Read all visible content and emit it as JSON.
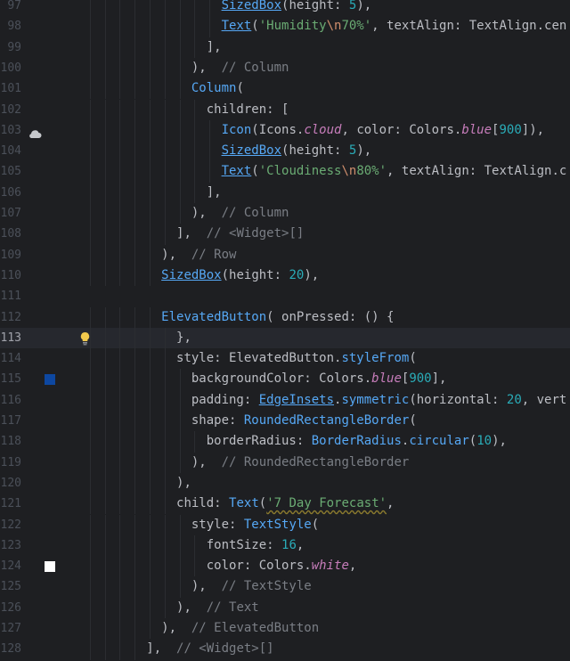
{
  "editor": {
    "current_line": 113,
    "lines": [
      {
        "n": "97",
        "indent": 10,
        "tokens": [
          {
            "t": "SizedBox",
            "c": "cls-u"
          },
          {
            "t": "(",
            "c": "pn"
          },
          {
            "t": "height: ",
            "c": "named"
          },
          {
            "t": "5",
            "c": "num"
          },
          {
            "t": "),",
            "c": "pn"
          }
        ]
      },
      {
        "n": "98",
        "indent": 10,
        "tokens": [
          {
            "t": "Text",
            "c": "cls-u"
          },
          {
            "t": "(",
            "c": "pn"
          },
          {
            "t": "'Humidity",
            "c": "str"
          },
          {
            "t": "\\n",
            "c": "esc"
          },
          {
            "t": "70%'",
            "c": "str"
          },
          {
            "t": ", ",
            "c": "pn"
          },
          {
            "t": "textAlign: ",
            "c": "named"
          },
          {
            "t": "TextAlign.cen",
            "c": "id"
          }
        ]
      },
      {
        "n": "99",
        "indent": 9,
        "tokens": [
          {
            "t": "],",
            "c": "pn"
          }
        ]
      },
      {
        "n": "100",
        "indent": 8,
        "tokens": [
          {
            "t": "),  ",
            "c": "pn"
          },
          {
            "t": "// Column",
            "c": "cm"
          }
        ]
      },
      {
        "n": "101",
        "indent": 8,
        "tokens": [
          {
            "t": "Column",
            "c": "cls"
          },
          {
            "t": "(",
            "c": "pn"
          }
        ]
      },
      {
        "n": "102",
        "indent": 9,
        "tokens": [
          {
            "t": "children: [",
            "c": "named"
          }
        ]
      },
      {
        "n": "103",
        "indent": 10,
        "gutter": "cloud-icon",
        "tokens": [
          {
            "t": "Icon",
            "c": "cls"
          },
          {
            "t": "(Icons.",
            "c": "pn"
          },
          {
            "t": "cloud",
            "c": "static"
          },
          {
            "t": ", color: Colors.",
            "c": "pn"
          },
          {
            "t": "blue",
            "c": "static"
          },
          {
            "t": "[",
            "c": "pn"
          },
          {
            "t": "900",
            "c": "num"
          },
          {
            "t": "]),",
            "c": "pn"
          }
        ]
      },
      {
        "n": "104",
        "indent": 10,
        "tokens": [
          {
            "t": "SizedBox",
            "c": "cls-u"
          },
          {
            "t": "(",
            "c": "pn"
          },
          {
            "t": "height: ",
            "c": "named"
          },
          {
            "t": "5",
            "c": "num"
          },
          {
            "t": "),",
            "c": "pn"
          }
        ]
      },
      {
        "n": "105",
        "indent": 10,
        "tokens": [
          {
            "t": "Text",
            "c": "cls-u"
          },
          {
            "t": "(",
            "c": "pn"
          },
          {
            "t": "'Cloudiness",
            "c": "str"
          },
          {
            "t": "\\n",
            "c": "esc"
          },
          {
            "t": "80%'",
            "c": "str"
          },
          {
            "t": ", ",
            "c": "pn"
          },
          {
            "t": "textAlign: ",
            "c": "named"
          },
          {
            "t": "TextAlign.c",
            "c": "id"
          }
        ]
      },
      {
        "n": "106",
        "indent": 9,
        "tokens": [
          {
            "t": "],",
            "c": "pn"
          }
        ]
      },
      {
        "n": "107",
        "indent": 8,
        "tokens": [
          {
            "t": "),  ",
            "c": "pn"
          },
          {
            "t": "// Column",
            "c": "cm"
          }
        ]
      },
      {
        "n": "108",
        "indent": 7,
        "tokens": [
          {
            "t": "],  ",
            "c": "pn"
          },
          {
            "t": "// <Widget>[]",
            "c": "cm"
          }
        ]
      },
      {
        "n": "109",
        "indent": 6,
        "tokens": [
          {
            "t": "),  ",
            "c": "pn"
          },
          {
            "t": "// Row",
            "c": "cm"
          }
        ]
      },
      {
        "n": "110",
        "indent": 6,
        "tokens": [
          {
            "t": "SizedBox",
            "c": "cls-u"
          },
          {
            "t": "(",
            "c": "pn"
          },
          {
            "t": "height: ",
            "c": "named"
          },
          {
            "t": "20",
            "c": "num"
          },
          {
            "t": "),",
            "c": "pn"
          }
        ]
      },
      {
        "n": "111",
        "indent": 0,
        "tokens": []
      },
      {
        "n": "112",
        "indent": 6,
        "tokens": [
          {
            "t": "ElevatedButton",
            "c": "cls"
          },
          {
            "t": "( onPressed: () {",
            "c": "pn"
          }
        ]
      },
      {
        "n": "113",
        "indent": 7,
        "gutter": "bulb-icon",
        "tokens": [
          {
            "t": "},",
            "c": "pn"
          }
        ]
      },
      {
        "n": "114",
        "indent": 7,
        "tokens": [
          {
            "t": "style: ElevatedButton.",
            "c": "pn"
          },
          {
            "t": "styleFrom",
            "c": "cls"
          },
          {
            "t": "(",
            "c": "pn"
          }
        ]
      },
      {
        "n": "115",
        "indent": 8,
        "gutter": "blue-swatch",
        "tokens": [
          {
            "t": "backgroundColor: Colors.",
            "c": "pn"
          },
          {
            "t": "blue",
            "c": "static"
          },
          {
            "t": "[",
            "c": "pn"
          },
          {
            "t": "900",
            "c": "num"
          },
          {
            "t": "],",
            "c": "pn"
          }
        ]
      },
      {
        "n": "116",
        "indent": 8,
        "tokens": [
          {
            "t": "padding: ",
            "c": "named"
          },
          {
            "t": "EdgeInsets",
            "c": "cls-u"
          },
          {
            "t": ".",
            "c": "pn"
          },
          {
            "t": "symmetric",
            "c": "cls"
          },
          {
            "t": "(horizontal: ",
            "c": "pn"
          },
          {
            "t": "20",
            "c": "num"
          },
          {
            "t": ", vert",
            "c": "pn"
          }
        ]
      },
      {
        "n": "117",
        "indent": 8,
        "tokens": [
          {
            "t": "shape: ",
            "c": "named"
          },
          {
            "t": "RoundedRectangleBorder",
            "c": "cls"
          },
          {
            "t": "(",
            "c": "pn"
          }
        ]
      },
      {
        "n": "118",
        "indent": 9,
        "tokens": [
          {
            "t": "borderRadius: ",
            "c": "named"
          },
          {
            "t": "BorderRadius",
            "c": "cls"
          },
          {
            "t": ".",
            "c": "pn"
          },
          {
            "t": "circular",
            "c": "cls"
          },
          {
            "t": "(",
            "c": "pn"
          },
          {
            "t": "10",
            "c": "num"
          },
          {
            "t": "),",
            "c": "pn"
          }
        ]
      },
      {
        "n": "119",
        "indent": 8,
        "tokens": [
          {
            "t": "),  ",
            "c": "pn"
          },
          {
            "t": "// RoundedRectangleBorder",
            "c": "cm"
          }
        ]
      },
      {
        "n": "120",
        "indent": 7,
        "tokens": [
          {
            "t": "),",
            "c": "pn"
          }
        ]
      },
      {
        "n": "121",
        "indent": 7,
        "tokens": [
          {
            "t": "child: ",
            "c": "named"
          },
          {
            "t": "Text",
            "c": "cls"
          },
          {
            "t": "(",
            "c": "pn"
          },
          {
            "t": "'7 Day Forecast'",
            "c": "str",
            "sq": true
          },
          {
            "t": ",",
            "c": "pn"
          }
        ]
      },
      {
        "n": "122",
        "indent": 8,
        "tokens": [
          {
            "t": "style: ",
            "c": "named"
          },
          {
            "t": "TextStyle",
            "c": "cls"
          },
          {
            "t": "(",
            "c": "pn"
          }
        ]
      },
      {
        "n": "123",
        "indent": 9,
        "tokens": [
          {
            "t": "fontSize: ",
            "c": "named"
          },
          {
            "t": "16",
            "c": "num"
          },
          {
            "t": ",",
            "c": "pn"
          }
        ]
      },
      {
        "n": "124",
        "indent": 9,
        "gutter": "white-swatch",
        "tokens": [
          {
            "t": "color: Colors.",
            "c": "pn"
          },
          {
            "t": "white",
            "c": "static"
          },
          {
            "t": ",",
            "c": "pn"
          }
        ]
      },
      {
        "n": "125",
        "indent": 8,
        "tokens": [
          {
            "t": "),  ",
            "c": "pn"
          },
          {
            "t": "// TextStyle",
            "c": "cm"
          }
        ]
      },
      {
        "n": "126",
        "indent": 7,
        "tokens": [
          {
            "t": "),  ",
            "c": "pn"
          },
          {
            "t": "// Text",
            "c": "cm"
          }
        ]
      },
      {
        "n": "127",
        "indent": 6,
        "tokens": [
          {
            "t": "),  ",
            "c": "pn"
          },
          {
            "t": "// ElevatedButton",
            "c": "cm"
          }
        ]
      },
      {
        "n": "128",
        "indent": 5,
        "tokens": [
          {
            "t": "],  ",
            "c": "pn"
          },
          {
            "t": "// <Widget>[]",
            "c": "cm"
          }
        ]
      }
    ],
    "colors": {
      "cloud": "#c6c8cc",
      "blue_swatch": "#0d47a1",
      "white_swatch": "#ffffff",
      "bulb": "#f2c94c"
    }
  }
}
